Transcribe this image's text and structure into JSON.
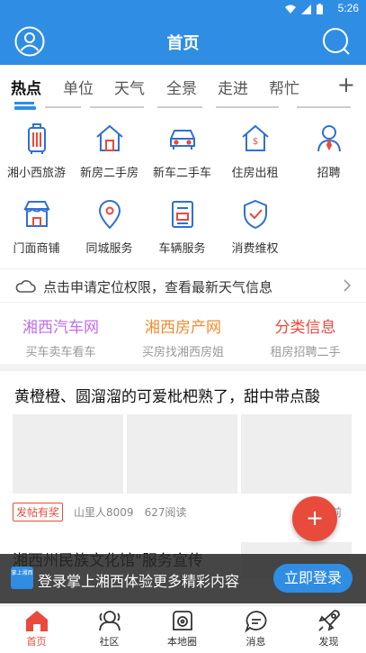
{
  "status_bar": {
    "time": "5:26",
    "icons": [
      "wifi-icon",
      "signal-icon",
      "battery-icon"
    ]
  },
  "header": {
    "title": "首页",
    "left_icon": "user-icon",
    "right_icon": "search-icon",
    "color": "#2f8de4"
  },
  "tabs": {
    "items": [
      {
        "label": "热点",
        "active": true
      },
      {
        "label": "单位"
      },
      {
        "label": "天气"
      },
      {
        "label": "全景"
      },
      {
        "label": "走进"
      },
      {
        "label": "帮忙"
      }
    ],
    "add_icon": "+"
  },
  "grid": [
    {
      "label": "湘小西旅游",
      "icon": "luggage-icon"
    },
    {
      "label": "新房二手房",
      "icon": "house-icon"
    },
    {
      "label": "新车二手车",
      "icon": "car-icon"
    },
    {
      "label": "住房出租",
      "icon": "rent-house-icon"
    },
    {
      "label": "招聘",
      "icon": "recruit-icon"
    },
    {
      "label": "门面商铺",
      "icon": "shop-icon"
    },
    {
      "label": "同城服务",
      "icon": "location-icon"
    },
    {
      "label": "车辆服务",
      "icon": "vehicle-doc-icon"
    },
    {
      "label": "消费维权",
      "icon": "shield-check-icon"
    }
  ],
  "weather": {
    "text": "点击申请定位权限，查看最新天气信息"
  },
  "sites": [
    {
      "title": "湘西汽车网",
      "subtitle": "买车卖车看车",
      "color": "#c06cf0"
    },
    {
      "title": "湘西房产网",
      "subtitle": "买房找湘西房姐",
      "color": "#f08c30"
    },
    {
      "title": "分类信息",
      "subtitle": "租房招聘二手",
      "color": "#e84a3c"
    }
  ],
  "article1": {
    "title": "黄橙橙、圆溜溜的可爱枇杷熟了，甜中带点酸",
    "badge": "发帖有奖",
    "author": "山里人8009",
    "reads": "627阅读",
    "time": "钟前"
  },
  "fab": {
    "label": "+"
  },
  "article2": {
    "title": "湘西州民族文化馆\"服务宣传"
  },
  "login_bar": {
    "logo_text": "掌上湘西",
    "text": "登录掌上湘西体验更多精彩内容",
    "button": "立即登录"
  },
  "nav": [
    {
      "label": "首页",
      "icon": "home-icon",
      "active": true
    },
    {
      "label": "社区",
      "icon": "community-icon"
    },
    {
      "label": "本地圈",
      "icon": "local-circle-icon"
    },
    {
      "label": "消息",
      "icon": "message-icon"
    },
    {
      "label": "发现",
      "icon": "discover-icon"
    }
  ]
}
